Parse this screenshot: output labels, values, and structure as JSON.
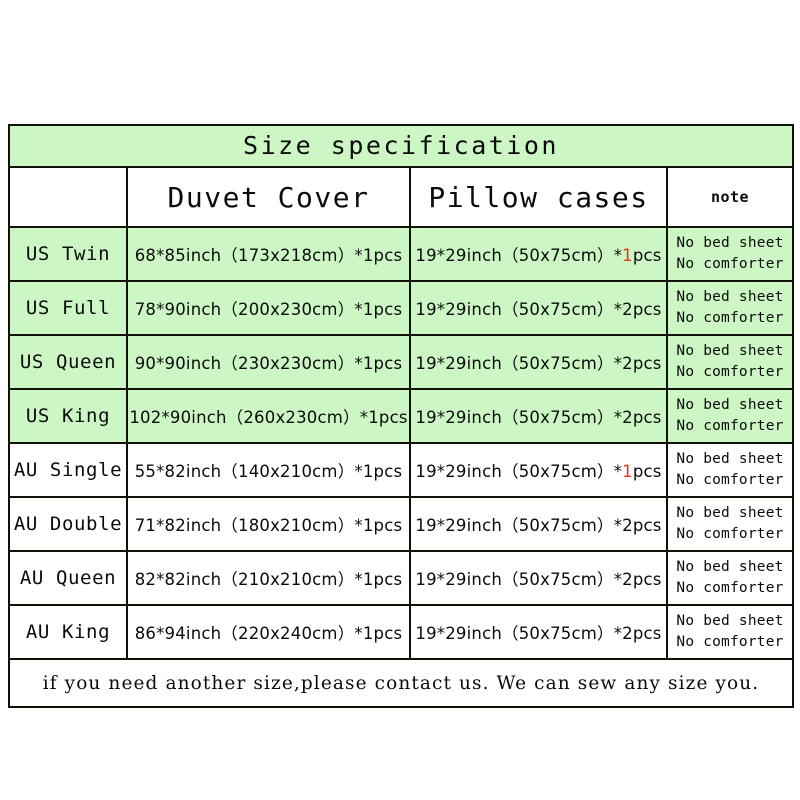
{
  "table": {
    "title": "Size specification",
    "columns": {
      "size_header": "",
      "duvet_header": "Duvet Cover",
      "pillow_header": "Pillow cases",
      "note_header": "note"
    },
    "rows": [
      {
        "size": "US Twin",
        "duvet": "68*85inch（173x218cm）*1pcs",
        "pillow_prefix": "19*29inch（50x75cm）*",
        "pillow_qty": "1",
        "pillow_suffix": "pcs",
        "pillow_qty_red": true,
        "note_line1": "No bed sheet",
        "note_line2": "No comforter",
        "shaded": true
      },
      {
        "size": "US Full",
        "duvet": "78*90inch（200x230cm）*1pcs",
        "pillow_prefix": "19*29inch（50x75cm）*",
        "pillow_qty": "2",
        "pillow_suffix": "pcs",
        "pillow_qty_red": false,
        "note_line1": "No bed sheet",
        "note_line2": "No comforter",
        "shaded": true
      },
      {
        "size": "US Queen",
        "duvet": "90*90inch（230x230cm）*1pcs",
        "pillow_prefix": "19*29inch（50x75cm）*",
        "pillow_qty": "2",
        "pillow_suffix": "pcs",
        "pillow_qty_red": false,
        "note_line1": "No bed sheet",
        "note_line2": "No comforter",
        "shaded": true
      },
      {
        "size": "US King",
        "duvet": "102*90inch（260x230cm）*1pcs",
        "pillow_prefix": "19*29inch（50x75cm）*",
        "pillow_qty": "2",
        "pillow_suffix": "pcs",
        "pillow_qty_red": false,
        "note_line1": "No bed sheet",
        "note_line2": "No comforter",
        "shaded": true
      },
      {
        "size": "AU Single",
        "duvet": "55*82inch（140x210cm）*1pcs",
        "pillow_prefix": "19*29inch（50x75cm）*",
        "pillow_qty": "1",
        "pillow_suffix": "pcs",
        "pillow_qty_red": true,
        "note_line1": "No bed sheet",
        "note_line2": "No comforter",
        "shaded": false
      },
      {
        "size": "AU Double",
        "duvet": "71*82inch（180x210cm）*1pcs",
        "pillow_prefix": "19*29inch（50x75cm）*",
        "pillow_qty": "2",
        "pillow_suffix": "pcs",
        "pillow_qty_red": false,
        "note_line1": "No bed sheet",
        "note_line2": "No comforter",
        "shaded": false
      },
      {
        "size": "AU Queen",
        "duvet": "82*82inch（210x210cm）*1pcs",
        "pillow_prefix": "19*29inch（50x75cm）*",
        "pillow_qty": "2",
        "pillow_suffix": "pcs",
        "pillow_qty_red": false,
        "note_line1": "No bed sheet",
        "note_line2": "No comforter",
        "shaded": false
      },
      {
        "size": "AU King",
        "duvet": "86*94inch（220x240cm）*1pcs",
        "pillow_prefix": "19*29inch（50x75cm）*",
        "pillow_qty": "2",
        "pillow_suffix": "pcs",
        "pillow_qty_red": false,
        "note_line1": "No bed sheet",
        "note_line2": "No comforter",
        "shaded": false
      }
    ],
    "footer": "if you need another size,please contact us. We can sew any size you."
  },
  "colors": {
    "shade_green": "#ccf7c4",
    "title_red": "#f5111b",
    "footer_red": "#ee1420",
    "qty_red": "#e8371d",
    "border": "#111108",
    "text": "#101010",
    "page_background": "#ffffff"
  }
}
